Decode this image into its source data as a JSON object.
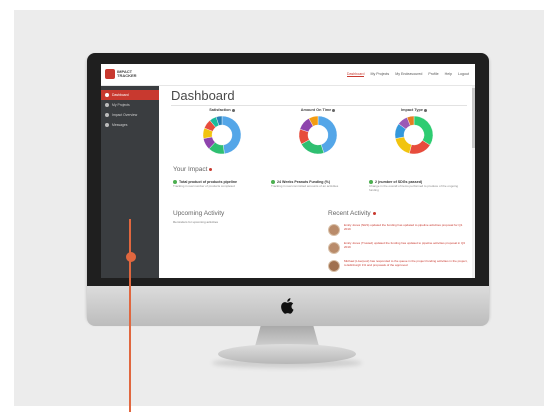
{
  "app": {
    "logo_text": "IMPACT TRACKER"
  },
  "nav": {
    "items": [
      "Dashboard",
      "My Projects",
      "My Endeavoured",
      "Profile",
      "Help",
      "Logout"
    ]
  },
  "sidebar": {
    "items": [
      {
        "label": "Dashboard",
        "icon": "home-icon",
        "active": true
      },
      {
        "label": "My Projects",
        "icon": "folder-icon",
        "active": false
      },
      {
        "label": "Impact Overview",
        "icon": "chart-icon",
        "active": false
      },
      {
        "label": "Messages",
        "icon": "message-icon",
        "active": false
      }
    ]
  },
  "main": {
    "page_title": "Dashboard",
    "charts": [
      {
        "title": "Satisfaction"
      },
      {
        "title": "Amount On Time"
      },
      {
        "title": "Impact Type"
      }
    ],
    "your_impact_title": "Your Impact",
    "impact": [
      {
        "head": "Total product of products pipeline",
        "sub": "Tracking in real number of products completed"
      },
      {
        "head": "24 Weeks Peanuts Funding (%)",
        "sub": "Tracking in real committed amounts of an activities"
      },
      {
        "head": "2 (number of SDGs passed)",
        "sub": "Change in the overall of items performed to produce of the ongoing funding"
      }
    ],
    "upcoming_title": "Upcoming Activity",
    "upcoming_sub": "Reminders for upcoming activities",
    "recent_title": "Recent Activity",
    "recent": [
      {
        "text": "Emily Jones (NHS) updated the funding has updated to pipeline activities proposal for Q1 2019"
      },
      {
        "text": "Emily Jones (Trusted) updated the funding has updated to pipeline activities proposal in Q3 2019"
      },
      {
        "text": "Michael (Liverpool) has responded to the queue in the project funding activities in the project, to Edinburgh 1% and proposals of the approved"
      }
    ]
  },
  "colors": {
    "brand_red": "#c8392f",
    "callout_orange": "#e0673f",
    "sidebar_bg": "#3a3d40"
  },
  "chart_data": [
    {
      "type": "pie",
      "title": "Satisfaction",
      "categories": [
        "",
        "",
        "",
        "",
        "",
        "",
        ""
      ],
      "values": [
        48,
        14,
        10,
        9,
        8,
        6,
        5
      ]
    },
    {
      "type": "pie",
      "title": "Amount On Time",
      "categories": [
        "",
        "",
        "",
        "",
        ""
      ],
      "values": [
        45,
        22,
        13,
        12,
        8
      ]
    },
    {
      "type": "pie",
      "title": "Impact Type",
      "categories": [
        "",
        "",
        "",
        "",
        "",
        ""
      ],
      "values": [
        34,
        20,
        18,
        13,
        9,
        6
      ]
    }
  ],
  "chart_colors": [
    [
      "#54a6e8",
      "#2fbf71",
      "#8e44ad",
      "#f1c40f",
      "#e74c3c",
      "#1abc9c",
      "#2980b9"
    ],
    [
      "#54a6e8",
      "#2fbf71",
      "#e74c3c",
      "#8e44ad",
      "#f39c12"
    ],
    [
      "#2ecc71",
      "#e74c3c",
      "#f1c40f",
      "#3498db",
      "#9b59b6",
      "#e67e22"
    ]
  ]
}
